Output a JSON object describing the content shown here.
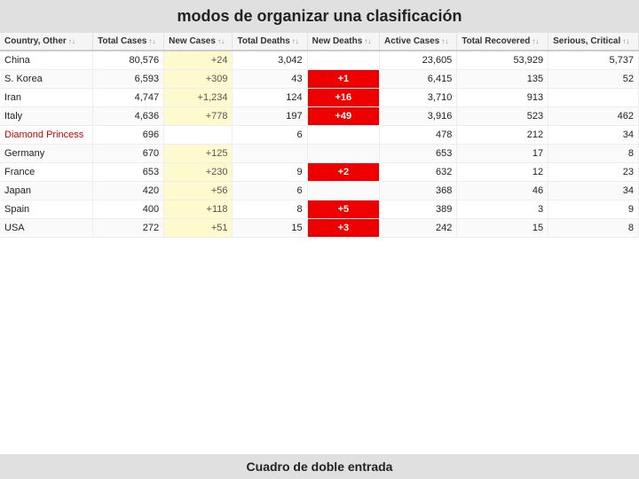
{
  "title": "modos de organizar una clasificación",
  "footer": "Cuadro de doble entrada",
  "columns": [
    {
      "id": "country",
      "label": "Country, Other",
      "sortable": true
    },
    {
      "id": "total_cases",
      "label": "Total Cases",
      "sortable": true
    },
    {
      "id": "new_cases",
      "label": "New Cases",
      "sortable": true
    },
    {
      "id": "total_deaths",
      "label": "Total Deaths",
      "sortable": true
    },
    {
      "id": "new_deaths",
      "label": "New Deaths",
      "sortable": true
    },
    {
      "id": "active_cases",
      "label": "Active Cases",
      "sortable": true
    },
    {
      "id": "total_recovered",
      "label": "Total Recovered",
      "sortable": true
    },
    {
      "id": "serious_critical",
      "label": "Serious, Critical",
      "sortable": true
    }
  ],
  "rows": [
    {
      "country": "China",
      "country_link": false,
      "total_cases": "80,576",
      "new_cases": "+24",
      "new_cases_highlight": "yellow",
      "total_deaths": "3,042",
      "new_deaths": "",
      "new_deaths_highlight": "",
      "active_cases": "23,605",
      "total_recovered": "53,929",
      "serious_critical": "5,737"
    },
    {
      "country": "S. Korea",
      "country_link": false,
      "total_cases": "6,593",
      "new_cases": "+309",
      "new_cases_highlight": "yellow",
      "total_deaths": "43",
      "new_deaths": "+1",
      "new_deaths_highlight": "red",
      "active_cases": "6,415",
      "total_recovered": "135",
      "serious_critical": "52"
    },
    {
      "country": "Iran",
      "country_link": false,
      "total_cases": "4,747",
      "new_cases": "+1,234",
      "new_cases_highlight": "yellow",
      "total_deaths": "124",
      "new_deaths": "+16",
      "new_deaths_highlight": "red",
      "active_cases": "3,710",
      "total_recovered": "913",
      "serious_critical": ""
    },
    {
      "country": "Italy",
      "country_link": false,
      "total_cases": "4,636",
      "new_cases": "+778",
      "new_cases_highlight": "yellow",
      "total_deaths": "197",
      "new_deaths": "+49",
      "new_deaths_highlight": "red",
      "active_cases": "3,916",
      "total_recovered": "523",
      "serious_critical": "462"
    },
    {
      "country": "Diamond Princess",
      "country_link": true,
      "total_cases": "696",
      "new_cases": "",
      "new_cases_highlight": "",
      "total_deaths": "6",
      "new_deaths": "",
      "new_deaths_highlight": "",
      "active_cases": "478",
      "total_recovered": "212",
      "serious_critical": "34"
    },
    {
      "country": "Germany",
      "country_link": false,
      "total_cases": "670",
      "new_cases": "+125",
      "new_cases_highlight": "yellow",
      "total_deaths": "",
      "new_deaths": "",
      "new_deaths_highlight": "",
      "active_cases": "653",
      "total_recovered": "17",
      "serious_critical": "8"
    },
    {
      "country": "France",
      "country_link": false,
      "total_cases": "653",
      "new_cases": "+230",
      "new_cases_highlight": "yellow",
      "total_deaths": "9",
      "new_deaths": "+2",
      "new_deaths_highlight": "red",
      "active_cases": "632",
      "total_recovered": "12",
      "serious_critical": "23"
    },
    {
      "country": "Japan",
      "country_link": false,
      "total_cases": "420",
      "new_cases": "+56",
      "new_cases_highlight": "yellow",
      "total_deaths": "6",
      "new_deaths": "",
      "new_deaths_highlight": "",
      "active_cases": "368",
      "total_recovered": "46",
      "serious_critical": "34"
    },
    {
      "country": "Spain",
      "country_link": false,
      "total_cases": "400",
      "new_cases": "+118",
      "new_cases_highlight": "yellow",
      "total_deaths": "8",
      "new_deaths": "+5",
      "new_deaths_highlight": "red",
      "active_cases": "389",
      "total_recovered": "3",
      "serious_critical": "9"
    },
    {
      "country": "USA",
      "country_link": false,
      "total_cases": "272",
      "new_cases": "+51",
      "new_cases_highlight": "yellow",
      "total_deaths": "15",
      "new_deaths": "+3",
      "new_deaths_highlight": "red",
      "active_cases": "242",
      "total_recovered": "15",
      "serious_critical": "8"
    }
  ]
}
